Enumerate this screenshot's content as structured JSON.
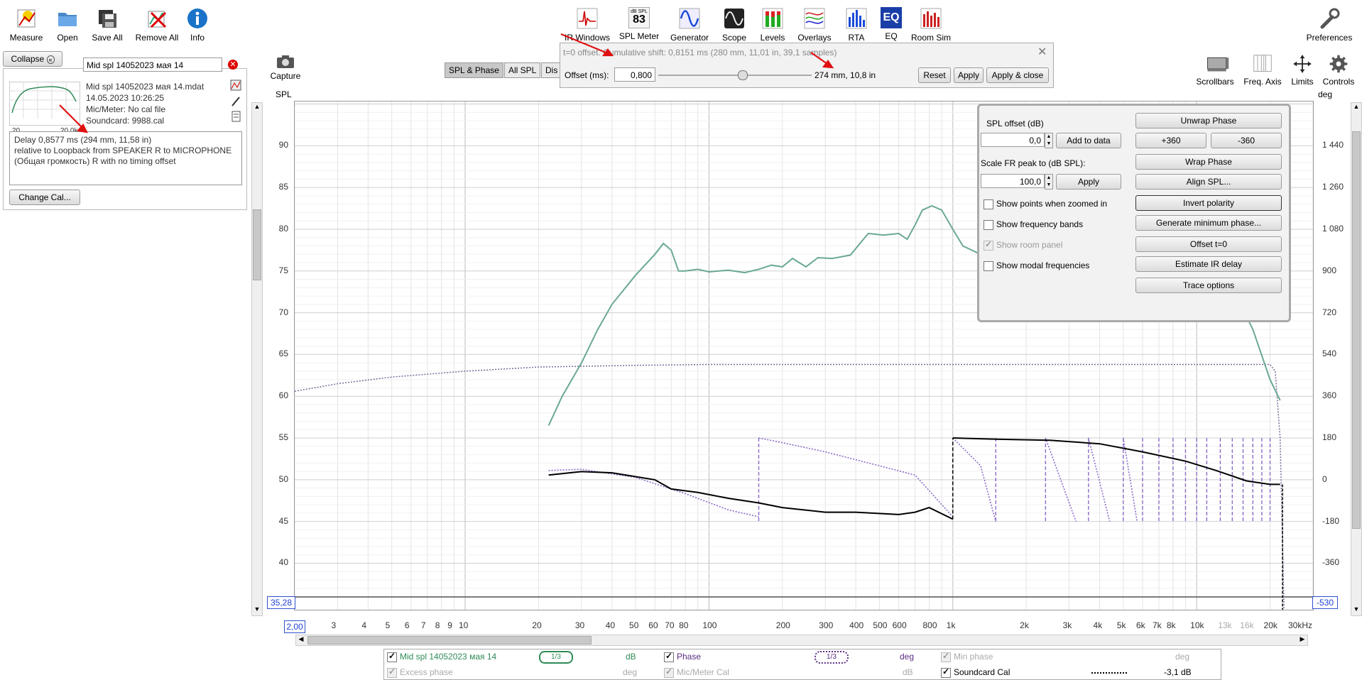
{
  "toolbar": {
    "left": [
      {
        "label": "Measure",
        "icon": "measure-icon"
      },
      {
        "label": "Open",
        "icon": "folder-icon"
      },
      {
        "label": "Save All",
        "icon": "save-icon"
      },
      {
        "label": "Remove All",
        "icon": "remove-icon"
      },
      {
        "label": "Info",
        "icon": "info-icon"
      }
    ],
    "center": [
      {
        "label": "IR Windows",
        "icon": "ir-windows-icon"
      },
      {
        "label": "SPL Meter",
        "icon": "spl-meter-icon",
        "badge_top": "dB SPL",
        "badge_value": "83"
      },
      {
        "label": "Generator",
        "icon": "generator-icon"
      },
      {
        "label": "Scope",
        "icon": "scope-icon"
      },
      {
        "label": "Levels",
        "icon": "levels-icon"
      },
      {
        "label": "Overlays",
        "icon": "overlays-icon"
      },
      {
        "label": "RTA",
        "icon": "rta-icon"
      },
      {
        "label": "EQ",
        "icon": "eq-icon"
      },
      {
        "label": "Room Sim",
        "icon": "room-sim-icon"
      }
    ],
    "preferences": "Preferences"
  },
  "left_panel": {
    "collapse": "Collapse",
    "measurement_name": "Mid spl 14052023 мая 14",
    "file": "Mid spl 14052023 мая 14.mdat",
    "date": "14.05.2023 10:26:25",
    "mic": "Mic/Meter: No cal file",
    "soundcard": "Soundcard: 9988.cal",
    "thumb_x0": "20",
    "thumb_x1": "20,0k",
    "notes_line1": "Delay 0,8577 ms (294 mm, 11,58 in)",
    "notes_line2": " relative to Loopback from SPEAKER R to MICROPHONE",
    "notes_line3": "(Общая громкость) R with no timing offset",
    "change_cal": "Change Cal..."
  },
  "capture": "Capture",
  "tabs": [
    "SPL & Phase",
    "All SPL",
    "Dis"
  ],
  "offset_popup": {
    "title": "t=0 offset. Cumulative shift: 0,8151 ms (280 mm, 11,01 in, 39,1 samples)",
    "offset_label": "Offset (ms):",
    "offset_value": "0,800",
    "readout": "274 mm, 10,8 in",
    "slider_fraction": 0.55,
    "reset": "Reset",
    "apply": "Apply",
    "apply_close": "Apply & close"
  },
  "right_tools": [
    {
      "label": "Scrollbars",
      "icon": "scrollbars-icon"
    },
    {
      "label": "Freq. Axis",
      "icon": "freq-axis-icon"
    },
    {
      "label": "Limits",
      "icon": "limits-icon"
    },
    {
      "label": "Controls",
      "icon": "gear-icon"
    }
  ],
  "axis": {
    "left_title": "SPL",
    "right_title": "deg",
    "left_ticks": [
      "90",
      "85",
      "80",
      "75",
      "70",
      "65",
      "60",
      "55",
      "50",
      "45",
      "40"
    ],
    "right_ticks": [
      "1 440",
      "1 260",
      "1 080",
      "900",
      "720",
      "540",
      "360",
      "180",
      "0",
      "-180",
      "-360"
    ],
    "left_min_box": "35,28",
    "right_min_box": "-530",
    "x_min_box": "2,00",
    "x_ticks": [
      "3",
      "4",
      "5",
      "6",
      "7",
      "8",
      "9",
      "10",
      "20",
      "30",
      "40",
      "50",
      "60",
      "70",
      "80",
      "100",
      "200",
      "300",
      "400",
      "500",
      "600",
      "800",
      "1k",
      "2k",
      "3k",
      "4k",
      "5k",
      "6k",
      "7k",
      "8k",
      "10k",
      "13k",
      "16k",
      "20k",
      "30kHz"
    ]
  },
  "controls_panel": {
    "spl_offset_label": "SPL offset (dB)",
    "spl_offset_value": "0,0",
    "add_to_data": "Add to data",
    "scale_label": "Scale FR peak to (dB SPL):",
    "scale_value": "100,0",
    "apply": "Apply",
    "show_points": "Show points when zoomed in",
    "show_bands": "Show frequency bands",
    "show_room": "Show room panel",
    "show_modal": "Show modal frequencies",
    "unwrap": "Unwrap Phase",
    "plus360": "+360",
    "minus360": "-360",
    "wrap": "Wrap Phase",
    "align": "Align SPL...",
    "invert": "Invert polarity",
    "minphase": "Generate minimum phase...",
    "offset": "Offset t=0",
    "estimate": "Estimate IR delay",
    "trace": "Trace options"
  },
  "legend": {
    "row1": [
      {
        "name": "Mid spl 14052023 мая 14",
        "smoothing": "1/3",
        "unit": "dB",
        "checked": true,
        "color": "#2e8b57"
      },
      {
        "name": "Phase",
        "smoothing": "1/3",
        "unit": "deg",
        "checked": true,
        "color": "#5a2d82"
      },
      {
        "name": "Min phase",
        "unit": "deg",
        "checked": true,
        "disabled": true
      }
    ],
    "row2": [
      {
        "name": "Excess phase",
        "unit": "deg",
        "checked": true,
        "disabled": true
      },
      {
        "name": "Mic/Meter Cal",
        "unit": "dB",
        "checked": true,
        "disabled": true
      },
      {
        "name": "Soundcard Cal",
        "unit": "-3,1 dB",
        "checked": true
      }
    ]
  },
  "colors": {
    "spl": "#6aa894",
    "phase": "#000000",
    "wrapped": "#8a6ac8",
    "cal": "#7a6a9a",
    "annotation": "#e01010"
  }
}
